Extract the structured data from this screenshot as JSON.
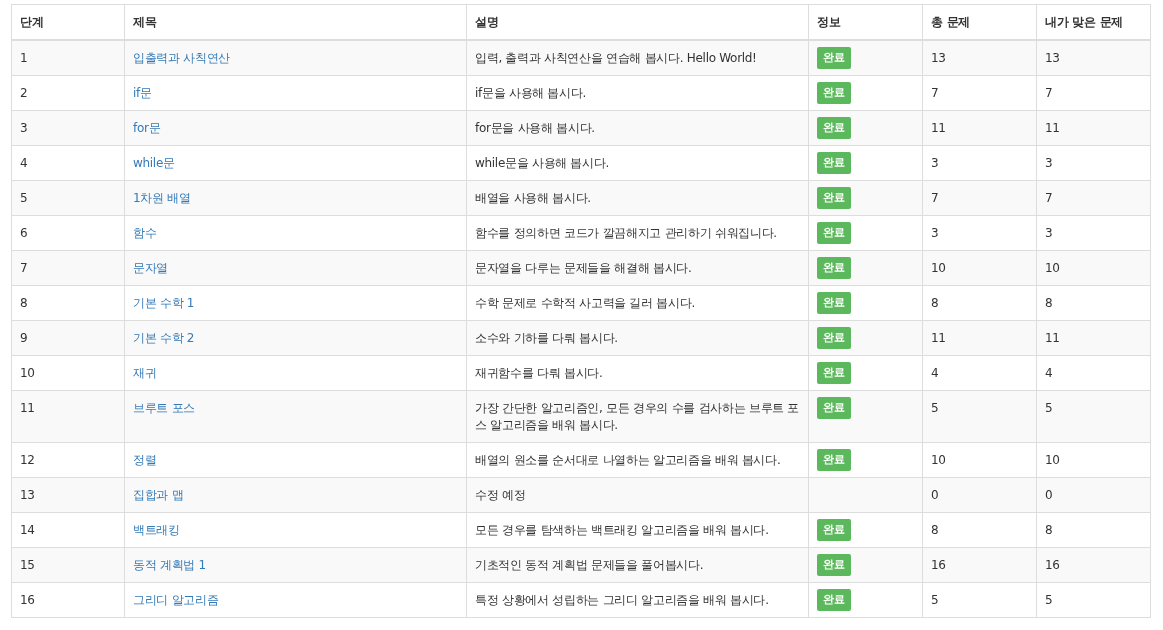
{
  "table": {
    "columns": [
      "단계",
      "제목",
      "설명",
      "정보",
      "총 문제",
      "내가 맞은 문제"
    ],
    "rows": [
      {
        "step": "1",
        "title": "입출력과 사칙연산",
        "description": "입력, 출력과 사칙연산을 연습해 봅시다. Hello World!",
        "info": "완료",
        "total": "13",
        "solved": "13"
      },
      {
        "step": "2",
        "title": "if문",
        "description": "if문을 사용해 봅시다.",
        "info": "완료",
        "total": "7",
        "solved": "7"
      },
      {
        "step": "3",
        "title": "for문",
        "description": "for문을 사용해 봅시다.",
        "info": "완료",
        "total": "11",
        "solved": "11"
      },
      {
        "step": "4",
        "title": "while문",
        "description": "while문을 사용해 봅시다.",
        "info": "완료",
        "total": "3",
        "solved": "3"
      },
      {
        "step": "5",
        "title": "1차원 배열",
        "description": "배열을 사용해 봅시다.",
        "info": "완료",
        "total": "7",
        "solved": "7"
      },
      {
        "step": "6",
        "title": "함수",
        "description": "함수를 정의하면 코드가 깔끔해지고 관리하기 쉬워집니다.",
        "info": "완료",
        "total": "3",
        "solved": "3"
      },
      {
        "step": "7",
        "title": "문자열",
        "description": "문자열을 다루는 문제들을 해결해 봅시다.",
        "info": "완료",
        "total": "10",
        "solved": "10"
      },
      {
        "step": "8",
        "title": "기본 수학 1",
        "description": "수학 문제로 수학적 사고력을 길러 봅시다.",
        "info": "완료",
        "total": "8",
        "solved": "8"
      },
      {
        "step": "9",
        "title": "기본 수학 2",
        "description": "소수와 기하를 다뤄 봅시다.",
        "info": "완료",
        "total": "11",
        "solved": "11"
      },
      {
        "step": "10",
        "title": "재귀",
        "description": "재귀함수를 다뤄 봅시다.",
        "info": "완료",
        "total": "4",
        "solved": "4"
      },
      {
        "step": "11",
        "title": "브루트 포스",
        "description": "가장 간단한 알고리즘인, 모든 경우의 수를 검사하는 브루트 포스 알고리즘을 배워 봅시다.",
        "info": "완료",
        "total": "5",
        "solved": "5"
      },
      {
        "step": "12",
        "title": "정렬",
        "description": "배열의 원소를 순서대로 나열하는 알고리즘을 배워 봅시다.",
        "info": "완료",
        "total": "10",
        "solved": "10"
      },
      {
        "step": "13",
        "title": "집합과 맵",
        "description": "수정 예정",
        "total": "0",
        "solved": "0"
      },
      {
        "step": "14",
        "title": "백트래킹",
        "description": "모든 경우를 탐색하는 백트래킹 알고리즘을 배워 봅시다.",
        "info": "완료",
        "total": "8",
        "solved": "8"
      },
      {
        "step": "15",
        "title": "동적 계획법 1",
        "description": "기초적인 동적 계획법 문제들을 풀어봅시다.",
        "info": "완료",
        "total": "16",
        "solved": "16"
      },
      {
        "step": "16",
        "title": "그리디 알고리즘",
        "description": "특정 상황에서 성립하는 그리디 알고리즘을 배워 봅시다.",
        "info": "완료",
        "total": "5",
        "solved": "5"
      }
    ]
  }
}
